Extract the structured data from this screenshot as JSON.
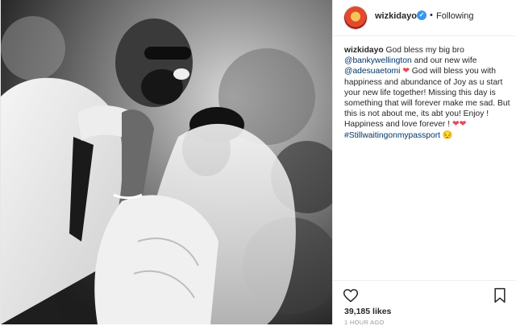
{
  "post": {
    "username": "wizkidayo",
    "follow_state": "Following",
    "separator": "•",
    "caption": {
      "author": "wizkidayo",
      "text_1": " God bless my big bro ",
      "mention_1": "@bankywellington",
      "text_2": " and our new wife ",
      "mention_2": "@adesuaetomi",
      "heart_1": " ❤",
      "text_3": " God will bless you with happiness and abundance of Joy as u start your new life together! Missing this day is something that will forever make me sad. But this is not about me, its abt you! Enjoy ! Happiness and love forever ! ",
      "heart_2": "❤❤",
      "hashtag": "#Stillwaitingonmypassport",
      "emoji": " 😔"
    },
    "likes": "39,185 likes",
    "time_ago": "1 HOUR AGO"
  },
  "icons": {
    "avatar": "avatar-image",
    "verified": "verified-badge-icon",
    "like": "heart-outline-icon",
    "save": "bookmark-outline-icon"
  },
  "colors": {
    "link": "#003569",
    "verified": "#3897f0",
    "heart": "#ed4956"
  }
}
